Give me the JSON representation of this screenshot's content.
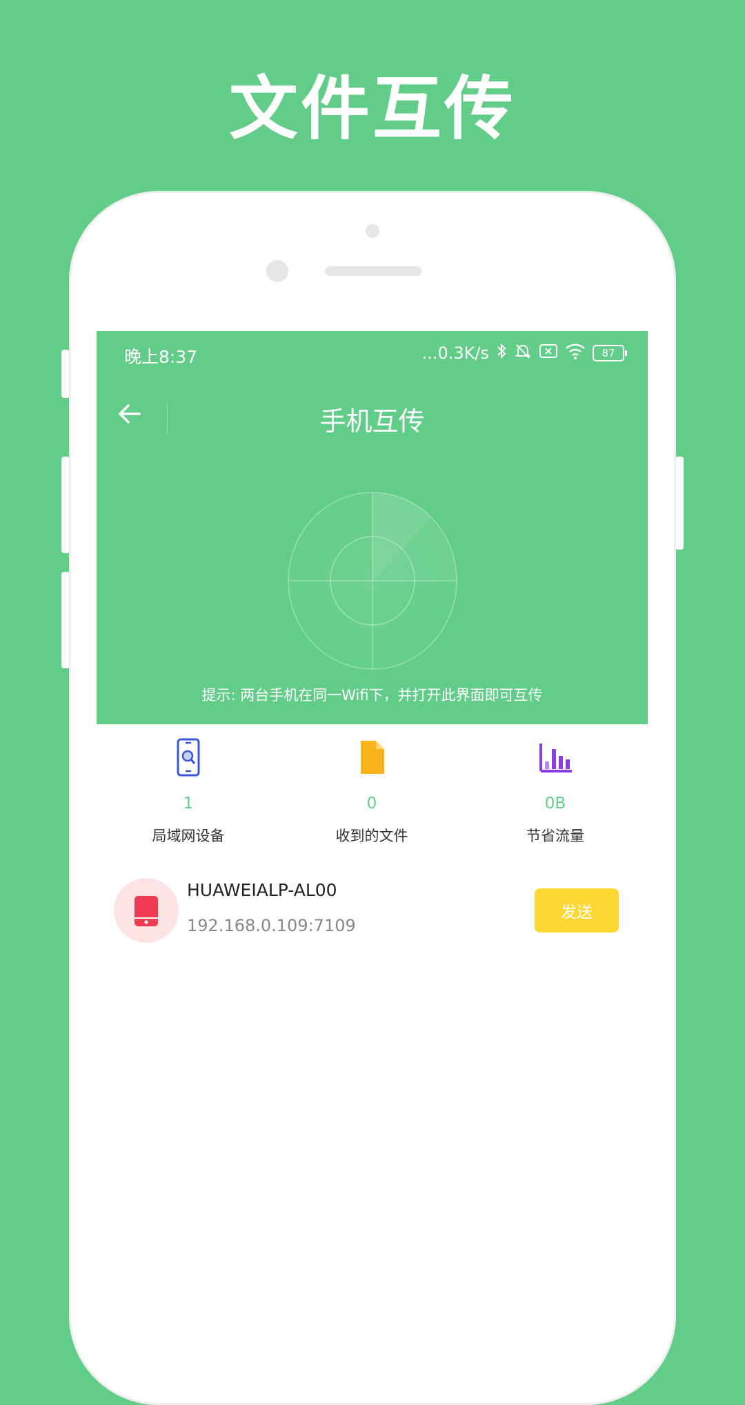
{
  "promo": {
    "title": "文件互传"
  },
  "status_bar": {
    "time": "晚上8:37",
    "network": "...0.3K/s",
    "battery": "87"
  },
  "nav": {
    "title": "手机互传"
  },
  "hint": "提示: 两台手机在同一Wifi下，并打开此界面即可互传",
  "stats": [
    {
      "value": "1",
      "label": "局域网设备",
      "icon": "phone-search-icon",
      "color": "#3b55d9"
    },
    {
      "value": "0",
      "label": "收到的文件",
      "icon": "file-icon",
      "color": "#fbb41c"
    },
    {
      "value": "0B",
      "label": "节省流量",
      "icon": "bar-chart-icon",
      "color": "#8a3ee0"
    }
  ],
  "device": {
    "name": "HUAWEIALP-AL00",
    "ip": "192.168.0.109:7109",
    "send_label": "发送",
    "icon": "phone-icon"
  },
  "colors": {
    "brand": "#62cd89",
    "send": "#fdd834",
    "device_icon": "#ee3b52"
  }
}
